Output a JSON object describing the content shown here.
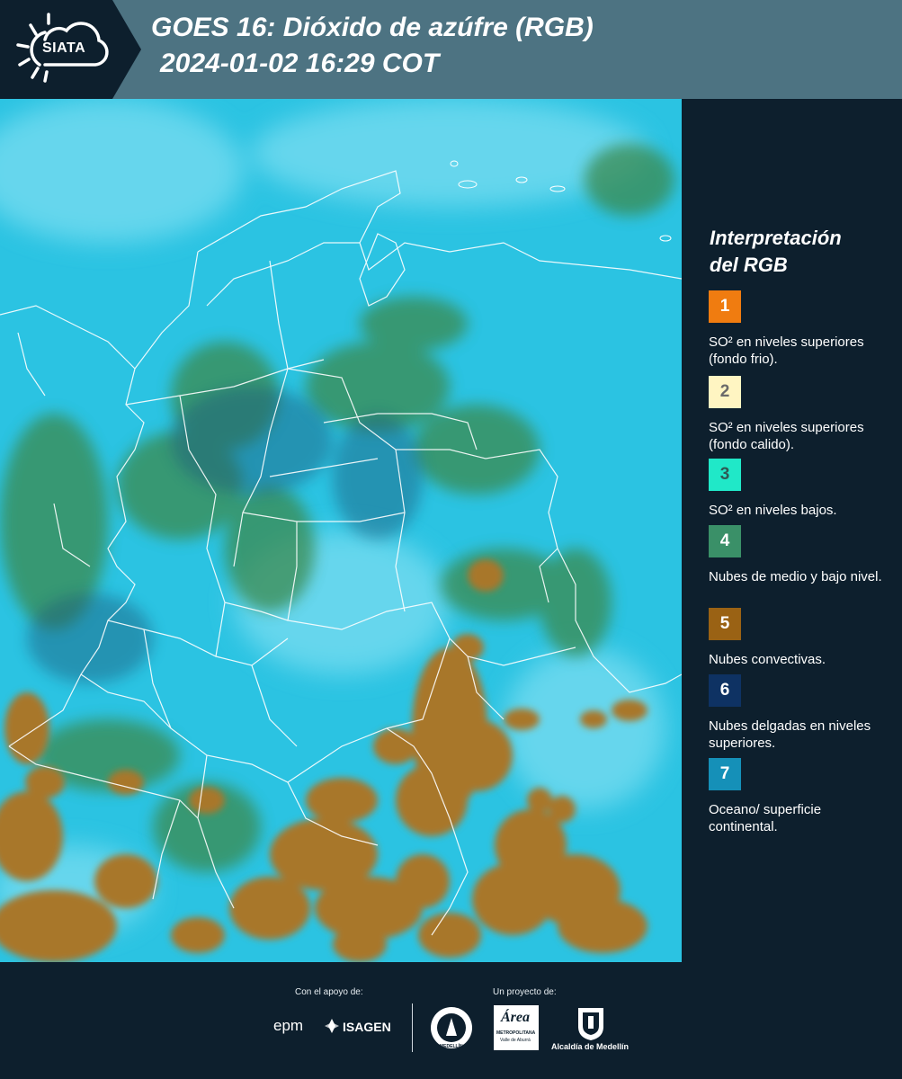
{
  "header": {
    "logo_text": "SIATA",
    "title_line1": "GOES 16: Dióxido de azúfre (RGB)",
    "title_line2": "2024-01-02 16:29 COT"
  },
  "legend": {
    "title_line1": "Interpretación",
    "title_line2": "del RGB",
    "items": [
      {
        "number": "1",
        "color": "#f07c10",
        "text_color": "#ffffff",
        "label": "SO² en niveles superiores (fondo frio)."
      },
      {
        "number": "2",
        "color": "#fff5c2",
        "text_color": "#6a6a6a",
        "label": "SO² en niveles superiores (fondo calido)."
      },
      {
        "number": "3",
        "color": "#20e8c8",
        "text_color": "#2e5a54",
        "label": "SO² en niveles bajos."
      },
      {
        "number": "4",
        "color": "#3a9068",
        "text_color": "#ffffff",
        "label": "Nubes de medio y bajo nivel."
      },
      {
        "number": "5",
        "color": "#9a6214",
        "text_color": "#ffffff",
        "label": "Nubes convectivas."
      },
      {
        "number": "6",
        "color": "#0e3263",
        "text_color": "#ffffff",
        "label": "Nubes delgadas en niveles superiores."
      },
      {
        "number": "7",
        "color": "#1590b8",
        "text_color": "#ffffff",
        "label": "Oceano/ superficie continental."
      }
    ]
  },
  "footer": {
    "support_label": "Con el apoyo de:",
    "project_label": "Un proyecto de:",
    "sponsor_epm": "epm",
    "sponsor_isagen": "ISAGEN",
    "area_name": "Área",
    "area_sub": "METROPOLITANA",
    "area_sub2": "Valle de Aburrá",
    "alcaldia": "Alcaldía de Medellín",
    "seal_text": "MEDELLÍN"
  },
  "map": {
    "ocean_color": "#27c0e0",
    "convective_color": "#a9782a",
    "lowcloud_color": "#3a8a50",
    "border_color": "#ffffff"
  }
}
